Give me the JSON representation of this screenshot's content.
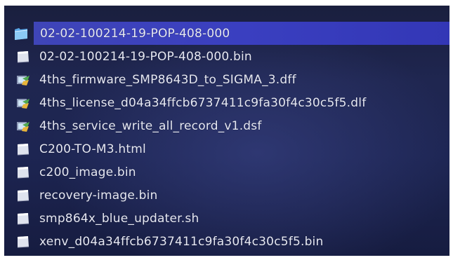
{
  "file_browser": {
    "accent_color": "#3a3fc0",
    "background_color": "#1d2552",
    "items": [
      {
        "name": "02-02-100214-19-POP-408-000",
        "icon": "folder-icon",
        "selected": true
      },
      {
        "name": "02-02-100214-19-POP-408-000.bin",
        "icon": "file-icon",
        "selected": false
      },
      {
        "name": "4ths_firmware_SMP8643D_to_SIGMA_3.dff",
        "icon": "script-file-icon",
        "selected": false
      },
      {
        "name": "4ths_license_d04a34ffcb6737411c9fa30f4c30c5f5.dlf",
        "icon": "script-file-icon",
        "selected": false
      },
      {
        "name": "4ths_service_write_all_record_v1.dsf",
        "icon": "script-file-icon",
        "selected": false
      },
      {
        "name": "C200-TO-M3.html",
        "icon": "file-icon",
        "selected": false
      },
      {
        "name": "c200_image.bin",
        "icon": "file-icon",
        "selected": false
      },
      {
        "name": "recovery-image.bin",
        "icon": "file-icon",
        "selected": false
      },
      {
        "name": "smp864x_blue_updater.sh",
        "icon": "file-icon",
        "selected": false
      },
      {
        "name": "xenv_d04a34ffcb6737411c9fa30f4c30c5f5.bin",
        "icon": "file-icon",
        "selected": false
      }
    ]
  }
}
